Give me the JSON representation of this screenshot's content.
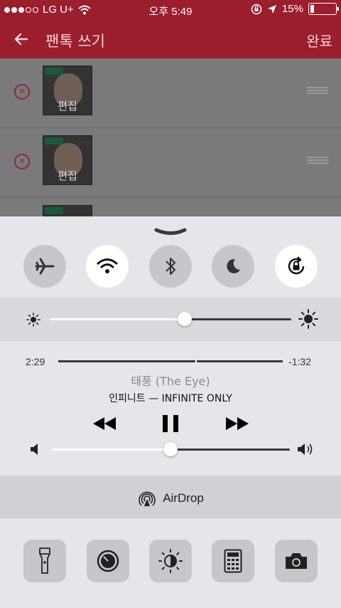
{
  "status_bar": {
    "carrier": "LG U+",
    "time": "오후 5:49",
    "battery": "15%",
    "battery_level": 0.15
  },
  "app": {
    "title": "팬톡 쓰기",
    "done_label": "완료",
    "rows": [
      {
        "edit_label": "편집"
      },
      {
        "edit_label": "편집"
      },
      {
        "edit_label": ""
      }
    ]
  },
  "control_center": {
    "toggles": [
      {
        "name": "airplane-mode",
        "icon": "airplane-icon",
        "on": false
      },
      {
        "name": "wifi",
        "icon": "wifi-icon",
        "on": true
      },
      {
        "name": "bluetooth",
        "icon": "bluetooth-icon",
        "on": false
      },
      {
        "name": "do-not-disturb",
        "icon": "moon-icon",
        "on": false
      },
      {
        "name": "rotation-lock",
        "icon": "rotation-lock-icon",
        "on": true
      }
    ],
    "brightness_level": 0.56,
    "media": {
      "elapsed": "2:29",
      "remaining": "-1:32",
      "progress": 0.61,
      "song_title": "태풍 (The Eye)",
      "artist_album": "인피니트 — INFINITE ONLY",
      "volume_level": 0.5
    },
    "airdrop_label": "AirDrop",
    "tools": [
      {
        "name": "flashlight",
        "icon": "flashlight-icon"
      },
      {
        "name": "timer",
        "icon": "timer-icon"
      },
      {
        "name": "night-shift",
        "icon": "night-shift-icon"
      },
      {
        "name": "calculator",
        "icon": "calculator-icon"
      },
      {
        "name": "camera",
        "icon": "camera-icon"
      }
    ],
    "colors": {
      "app_bar": "#9b1e2c",
      "toggle_on": "#ffffff",
      "toggle_off": "#c6c6cb"
    }
  }
}
